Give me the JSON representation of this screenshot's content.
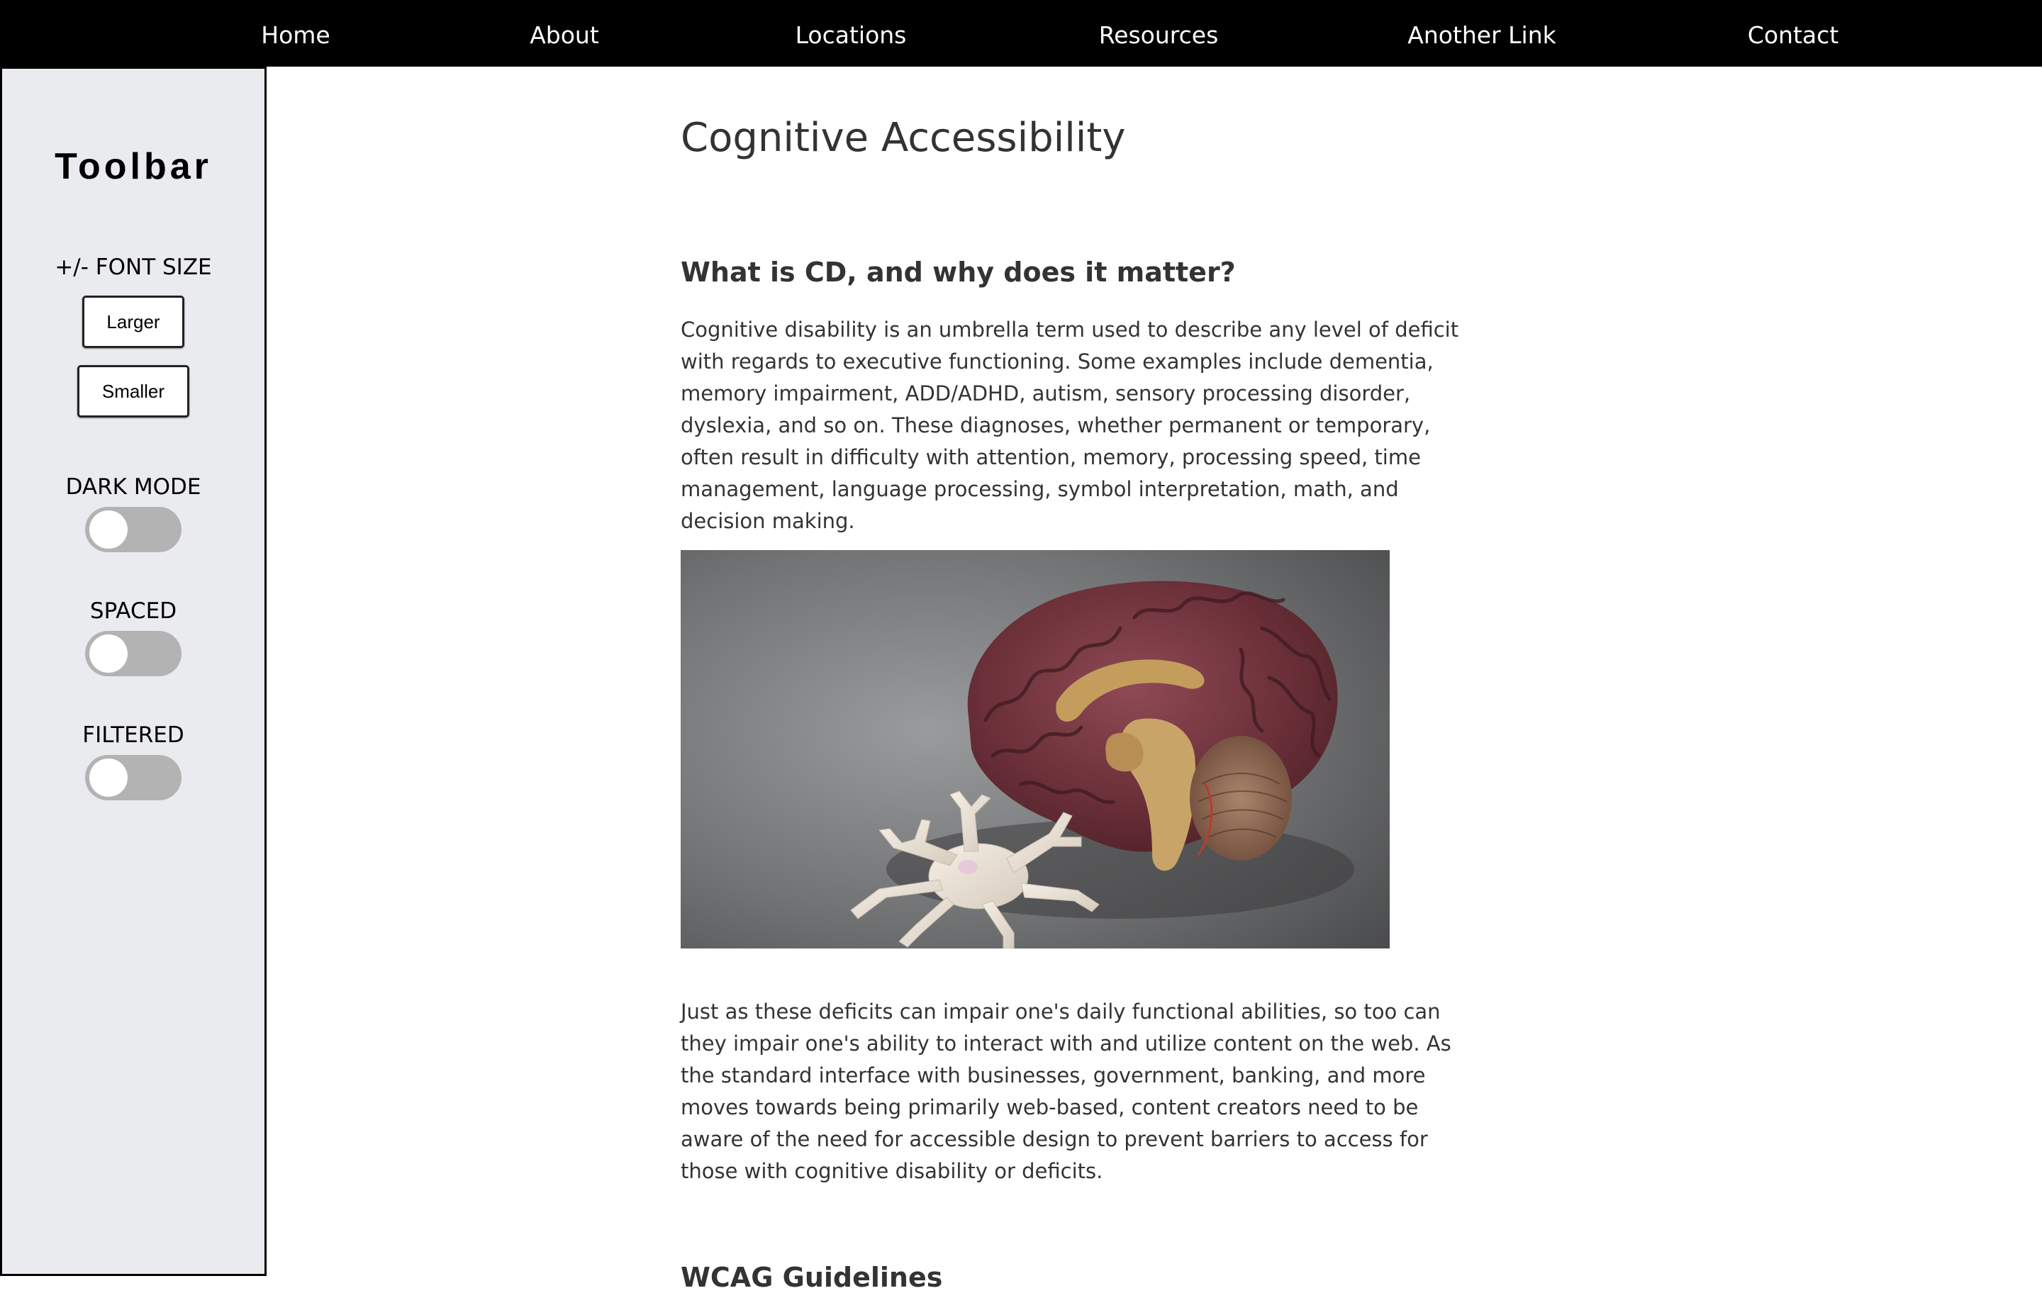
{
  "nav": {
    "items": [
      {
        "label": "Home"
      },
      {
        "label": "About"
      },
      {
        "label": "Locations"
      },
      {
        "label": "Resources"
      },
      {
        "label": "Another Link"
      },
      {
        "label": "Contact"
      }
    ]
  },
  "toolbar": {
    "title": "Toolbar",
    "font_size_label": "+/- FONT SIZE",
    "larger_label": "Larger",
    "smaller_label": "Smaller",
    "dark_mode_label": "DARK MODE",
    "dark_mode_on": false,
    "spaced_label": "SPACED",
    "spaced_on": false,
    "filtered_label": "FILTERED",
    "filtered_on": false
  },
  "main": {
    "title": "Cognitive Accessibility",
    "section1_heading": "What is CD, and why does it matter?",
    "paragraph1": "Cognitive disability is an umbrella term used to describe any level of deficit with regards to executive functioning. Some examples include dementia, memory impairment, ADD/ADHD, autism, sensory processing disorder, dyslexia, and so on. These diagnoses, whether permanent or temporary, often result in difficulty with attention, memory, processing speed, time management, language processing, symbol interpretation, math, and decision making.",
    "paragraph2": "Just as these deficits can impair one's daily functional abilities, so too can they impair one's ability to interact with and utilize content on the web. As the standard interface with businesses, government, banking, and more moves towards being primarily web-based, content creators need to be aware of the need for accessible design to prevent barriers to access for those with cognitive disability or deficits.",
    "section2_heading": "WCAG Guidelines"
  },
  "colors": {
    "nav_bg": "#000000",
    "sidebar_bg": "#eaebee",
    "text": "#333333",
    "toggle_off": "#b3b3b3"
  }
}
